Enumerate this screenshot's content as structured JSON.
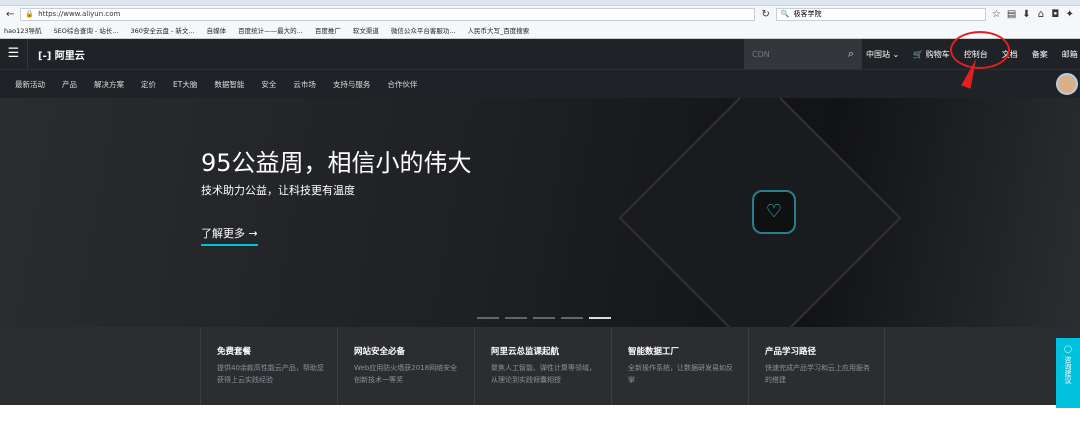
{
  "browser": {
    "url": "https://www.aliyun.com",
    "search_value": "极客学院",
    "bookmarks": [
      "hao123导航",
      "SEO综合查询 - 站长...",
      "360安全云盘 - 新文...",
      "自媒体",
      "百度统计——最大的...",
      "百度推广",
      "软文渠道",
      "微信公众平台客服功...",
      "人民币大写_百度搜索"
    ]
  },
  "header": {
    "logo": "阿里云",
    "search_placeholder": "CDN",
    "region": "中国站",
    "cart": "购物车",
    "console": "控制台",
    "docs": "文档",
    "beian": "备案",
    "mail": "邮箱"
  },
  "nav": [
    "最新活动",
    "产品",
    "解决方案",
    "定价",
    "ET大脑",
    "数据智能",
    "安全",
    "云市场",
    "支持与服务",
    "合作伙伴"
  ],
  "hero": {
    "title": "95公益周，相信小的伟大",
    "subtitle": "技术助力公益，让科技更有温度",
    "link": "了解更多 →",
    "slide_count": 5,
    "active_slide": 5
  },
  "cards": [
    {
      "title": "免费套餐",
      "desc": "提供40余款高性能云产品，帮助您获得上云实践经验"
    },
    {
      "title": "网站安全必备",
      "desc": "Web应用防火墙获2018网络安全创新技术一等奖"
    },
    {
      "title": "阿里云总监课起航",
      "desc": "聚焦人工智能、弹性计算等领域，从理论到实践倾囊相授"
    },
    {
      "title": "智能数据工厂",
      "desc": "全新操作系统，让数据研发易如反掌"
    },
    {
      "title": "产品学习路径",
      "desc": "快速完成产品学习和云上应用服务的搭建"
    }
  ],
  "float_button": "咨询建议"
}
